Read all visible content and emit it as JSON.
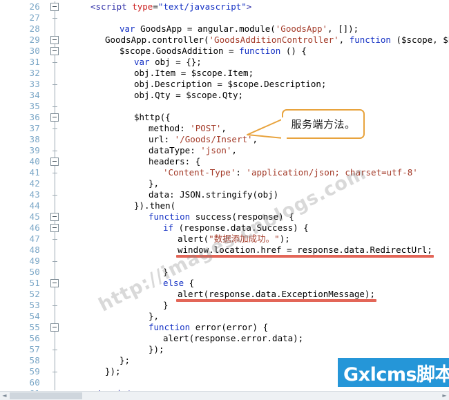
{
  "editor": {
    "first_line_number": 26,
    "line_height": 16,
    "lines": [
      {
        "n": 26,
        "indent": 2,
        "fold": true,
        "tokens": [
          {
            "t": "&lt;",
            "c": "tag"
          },
          {
            "t": "script",
            "c": "tag"
          },
          {
            "t": " ",
            "c": "pun"
          },
          {
            "t": "type",
            "c": "att"
          },
          {
            "t": "=",
            "c": "pun"
          },
          {
            "t": "\"text/javascript\"",
            "c": "val"
          },
          {
            "t": "&gt;",
            "c": "tag"
          }
        ]
      },
      {
        "n": 27,
        "indent": 0,
        "fold": false,
        "tokens": []
      },
      {
        "n": 28,
        "indent": 4,
        "fold": false,
        "tokens": [
          {
            "t": "var",
            "c": "k"
          },
          {
            "t": " GoodsApp = angular.module(",
            "c": "pun"
          },
          {
            "t": "'GoodsApp'",
            "c": "str"
          },
          {
            "t": ", []);",
            "c": "pun"
          }
        ]
      },
      {
        "n": 29,
        "indent": 3,
        "fold": true,
        "tokens": [
          {
            "t": "GoodsApp.controller(",
            "c": "pun"
          },
          {
            "t": "'GoodsAdditionController'",
            "c": "str"
          },
          {
            "t": ", ",
            "c": "pun"
          },
          {
            "t": "function",
            "c": "k"
          },
          {
            "t": " ($scope, $http) {",
            "c": "pun"
          }
        ]
      },
      {
        "n": 30,
        "indent": 4,
        "fold": true,
        "tokens": [
          {
            "t": "$scope.GoodsAddition = ",
            "c": "pun"
          },
          {
            "t": "function",
            "c": "k"
          },
          {
            "t": " () {",
            "c": "pun"
          }
        ]
      },
      {
        "n": 31,
        "indent": 5,
        "fold": false,
        "tokens": [
          {
            "t": "var",
            "c": "k"
          },
          {
            "t": " obj = {};",
            "c": "pun"
          }
        ]
      },
      {
        "n": 32,
        "indent": 5,
        "fold": false,
        "tokens": [
          {
            "t": "obj.Item = $scope.Item;",
            "c": "pun"
          }
        ]
      },
      {
        "n": 33,
        "indent": 5,
        "fold": false,
        "tokens": [
          {
            "t": "obj.Description = $scope.Description;",
            "c": "pun"
          }
        ]
      },
      {
        "n": 34,
        "indent": 5,
        "fold": false,
        "tokens": [
          {
            "t": "obj.Qty = $scope.Qty;",
            "c": "pun"
          }
        ]
      },
      {
        "n": 35,
        "indent": 0,
        "fold": false,
        "tokens": []
      },
      {
        "n": 36,
        "indent": 5,
        "fold": true,
        "tokens": [
          {
            "t": "$http({",
            "c": "pun"
          }
        ]
      },
      {
        "n": 37,
        "indent": 6,
        "fold": false,
        "tokens": [
          {
            "t": "method: ",
            "c": "pun"
          },
          {
            "t": "'POST'",
            "c": "str"
          },
          {
            "t": ",",
            "c": "pun"
          }
        ]
      },
      {
        "n": 38,
        "indent": 6,
        "fold": false,
        "tokens": [
          {
            "t": "url: ",
            "c": "pun"
          },
          {
            "t": "'/Goods/Insert'",
            "c": "str"
          },
          {
            "t": ",",
            "c": "pun"
          }
        ]
      },
      {
        "n": 39,
        "indent": 6,
        "fold": false,
        "tokens": [
          {
            "t": "dataType: ",
            "c": "pun"
          },
          {
            "t": "'json'",
            "c": "str"
          },
          {
            "t": ",",
            "c": "pun"
          }
        ]
      },
      {
        "n": 40,
        "indent": 6,
        "fold": true,
        "tokens": [
          {
            "t": "headers: {",
            "c": "pun"
          }
        ]
      },
      {
        "n": 41,
        "indent": 7,
        "fold": false,
        "tokens": [
          {
            "t": "'Content-Type'",
            "c": "str"
          },
          {
            "t": ": ",
            "c": "pun"
          },
          {
            "t": "'application/json; charset=utf-8'",
            "c": "str"
          }
        ]
      },
      {
        "n": 42,
        "indent": 6,
        "fold": false,
        "tokens": [
          {
            "t": "},",
            "c": "pun"
          }
        ]
      },
      {
        "n": 43,
        "indent": 6,
        "fold": false,
        "tokens": [
          {
            "t": "data: JSON.stringify(obj)",
            "c": "pun"
          }
        ]
      },
      {
        "n": 44,
        "indent": 5,
        "fold": false,
        "tokens": [
          {
            "t": "}).then(",
            "c": "pun"
          }
        ]
      },
      {
        "n": 45,
        "indent": 6,
        "fold": true,
        "tokens": [
          {
            "t": "function",
            "c": "k"
          },
          {
            "t": " success(response) {",
            "c": "pun"
          }
        ]
      },
      {
        "n": 46,
        "indent": 7,
        "fold": true,
        "tokens": [
          {
            "t": "if",
            "c": "k"
          },
          {
            "t": " (response.data.Success) {",
            "c": "pun"
          }
        ]
      },
      {
        "n": 47,
        "indent": 8,
        "fold": false,
        "tokens": [
          {
            "t": "alert(",
            "c": "pun"
          },
          {
            "t": "\"数据添加成功。\"",
            "c": "str"
          },
          {
            "t": ");",
            "c": "pun"
          }
        ]
      },
      {
        "n": 48,
        "indent": 8,
        "fold": false,
        "tokens": [
          {
            "t": "window.location.href = response.data.RedirectUrl;",
            "c": "pun"
          }
        ]
      },
      {
        "n": 49,
        "indent": 0,
        "fold": false,
        "tokens": []
      },
      {
        "n": 50,
        "indent": 7,
        "fold": false,
        "tokens": [
          {
            "t": "}",
            "c": "pun"
          }
        ]
      },
      {
        "n": 51,
        "indent": 7,
        "fold": true,
        "tokens": [
          {
            "t": "else",
            "c": "k"
          },
          {
            "t": " {",
            "c": "pun"
          }
        ]
      },
      {
        "n": 52,
        "indent": 8,
        "fold": false,
        "tokens": [
          {
            "t": "alert(response.data.ExceptionMessage);",
            "c": "pun"
          }
        ]
      },
      {
        "n": 53,
        "indent": 7,
        "fold": false,
        "tokens": [
          {
            "t": "}",
            "c": "pun"
          }
        ]
      },
      {
        "n": 54,
        "indent": 6,
        "fold": false,
        "tokens": [
          {
            "t": "},",
            "c": "pun"
          }
        ]
      },
      {
        "n": 55,
        "indent": 6,
        "fold": true,
        "tokens": [
          {
            "t": "function",
            "c": "k"
          },
          {
            "t": " error(error) {",
            "c": "pun"
          }
        ]
      },
      {
        "n": 56,
        "indent": 7,
        "fold": false,
        "tokens": [
          {
            "t": "alert(response.error.data);",
            "c": "pun"
          }
        ]
      },
      {
        "n": 57,
        "indent": 6,
        "fold": false,
        "tokens": [
          {
            "t": "});",
            "c": "pun"
          }
        ]
      },
      {
        "n": 58,
        "indent": 4,
        "fold": false,
        "tokens": [
          {
            "t": "};",
            "c": "pun"
          }
        ]
      },
      {
        "n": 59,
        "indent": 3,
        "fold": false,
        "tokens": [
          {
            "t": "});",
            "c": "pun"
          }
        ]
      },
      {
        "n": 60,
        "indent": 0,
        "fold": false,
        "tokens": []
      },
      {
        "n": 61,
        "indent": 2,
        "fold": false,
        "tokens": [
          {
            "t": "&lt;/",
            "c": "tag"
          },
          {
            "t": "script",
            "c": "tag"
          },
          {
            "t": "&gt;",
            "c": "tag"
          }
        ]
      }
    ]
  },
  "annotations": {
    "callout": {
      "text": "服务端方法。",
      "border_color": "#e8a33d",
      "points_to_line": 38
    },
    "underlines": [
      {
        "label": "window-location-href-underline",
        "line": 48,
        "color": "#dd4433"
      },
      {
        "label": "alert-exception-message-underline",
        "line": 52,
        "color": "#dd4433"
      }
    ]
  },
  "watermarks": {
    "diagonal_text": "http://images.cnblogs.com",
    "badge_text": "Gxlcms脚本",
    "badge_color": "#2596d8"
  },
  "scrollbar": {
    "left_arrow": "◄",
    "right_arrow": "►"
  }
}
